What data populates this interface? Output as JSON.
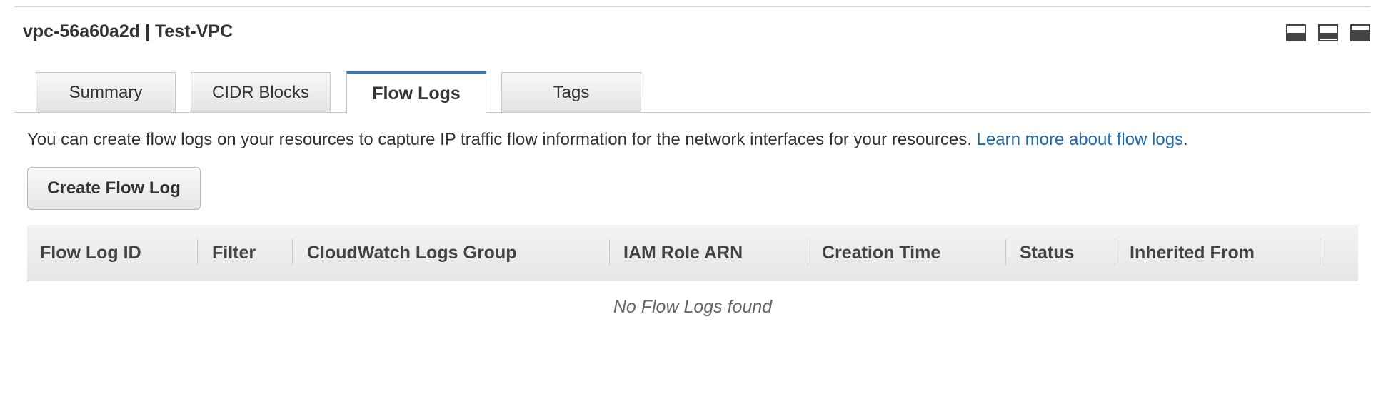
{
  "panel": {
    "title": "vpc-56a60a2d | Test-VPC"
  },
  "layout_icons": [
    "panel-bottom-icon",
    "panel-middle-icon",
    "panel-full-icon"
  ],
  "tabs": [
    {
      "label": "Summary",
      "active": false
    },
    {
      "label": "CIDR Blocks",
      "active": false
    },
    {
      "label": "Flow Logs",
      "active": true
    },
    {
      "label": "Tags",
      "active": false
    }
  ],
  "info": {
    "text": "You can create flow logs on your resources to capture IP traffic flow information for the network interfaces for your resources.",
    "link": "Learn more about flow logs",
    "suffix": "."
  },
  "actions": {
    "create_label": "Create Flow Log"
  },
  "table": {
    "columns": [
      "Flow Log ID",
      "Filter",
      "CloudWatch Logs Group",
      "IAM Role ARN",
      "Creation Time",
      "Status",
      "Inherited From"
    ],
    "empty_message": "No Flow Logs found"
  },
  "colors": {
    "accent": "#3b73b9",
    "link": "#1f6ab1"
  }
}
